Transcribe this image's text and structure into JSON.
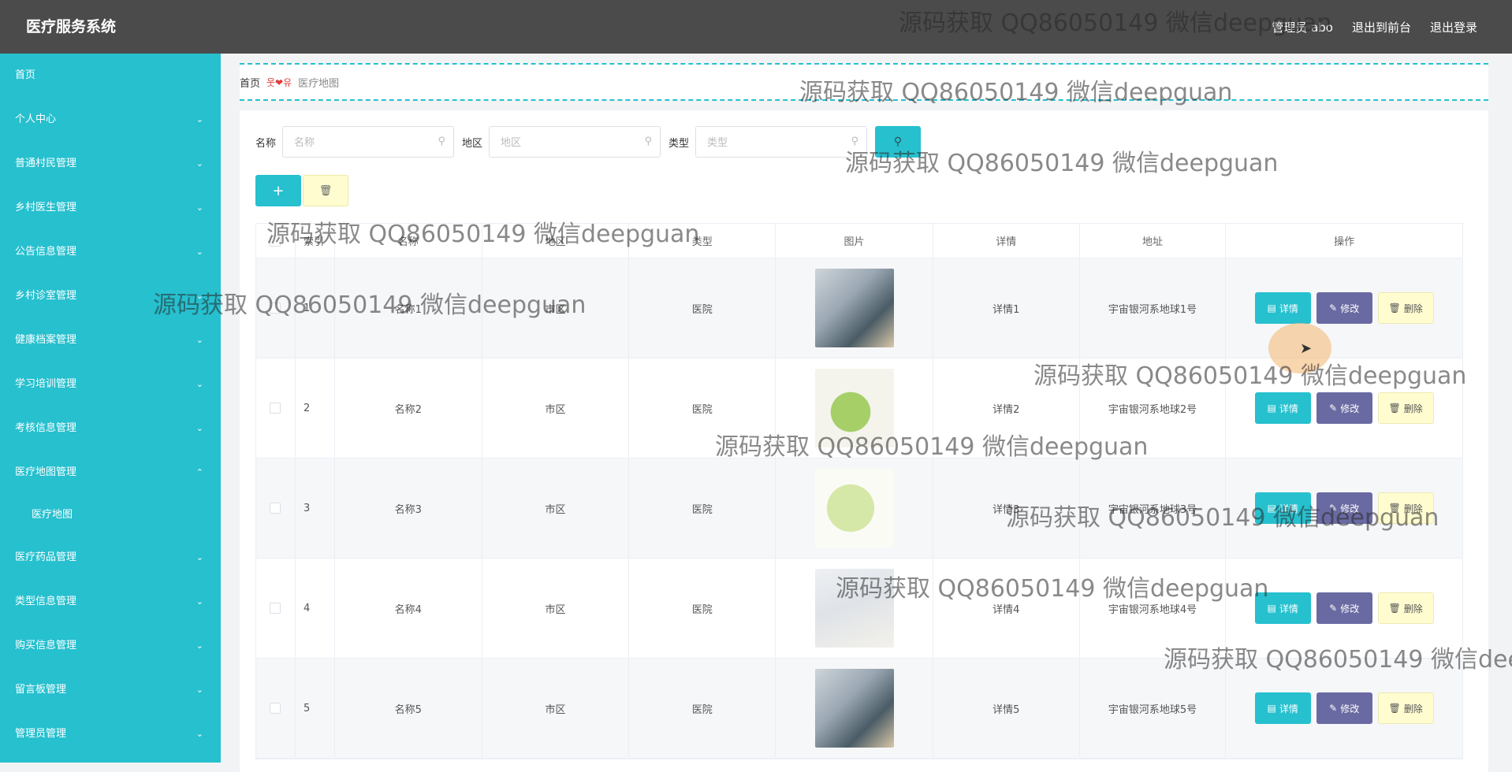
{
  "app": {
    "title": "医疗服务系统"
  },
  "header": {
    "user": "管理员 abo",
    "to_front": "退出到前台",
    "logout": "退出登录"
  },
  "sidebar": {
    "items": [
      {
        "label": "首页",
        "chev": ""
      },
      {
        "label": "个人中心",
        "chev": "⌄"
      },
      {
        "label": "普通村民管理",
        "chev": "⌄"
      },
      {
        "label": "乡村医生管理",
        "chev": "⌄"
      },
      {
        "label": "公告信息管理",
        "chev": "⌄"
      },
      {
        "label": "乡村诊室管理",
        "chev": "⌄"
      },
      {
        "label": "健康档案管理",
        "chev": "⌄"
      },
      {
        "label": "学习培训管理",
        "chev": "⌄"
      },
      {
        "label": "考核信息管理",
        "chev": "⌄"
      },
      {
        "label": "医疗地图管理",
        "chev": "⌃"
      },
      {
        "label": "医疗地图",
        "chev": ""
      },
      {
        "label": "医疗药品管理",
        "chev": "⌄"
      },
      {
        "label": "类型信息管理",
        "chev": "⌄"
      },
      {
        "label": "购买信息管理",
        "chev": "⌄"
      },
      {
        "label": "留言板管理",
        "chev": "⌄"
      },
      {
        "label": "管理员管理",
        "chev": "⌄"
      }
    ]
  },
  "breadcrumb": {
    "home": "首页",
    "sep": "웃❤유",
    "current": "医疗地图"
  },
  "search": {
    "name_label": "名称",
    "name_placeholder": "名称",
    "region_label": "地区",
    "region_placeholder": "地区",
    "type_label": "类型",
    "type_placeholder": "类型",
    "search_icon": "⚲"
  },
  "toolbar": {
    "add_icon": "+",
    "delete_icon": "🗑"
  },
  "table": {
    "headers": {
      "index": "索引",
      "name": "名称",
      "region": "地区",
      "type": "类型",
      "image": "图片",
      "detail": "详情",
      "address": "地址",
      "ops": "操作"
    },
    "buttons": {
      "detail": "详情",
      "edit": "修改",
      "remove": "删除"
    },
    "button_icons": {
      "detail": "▤",
      "edit": "✎",
      "remove": "🗑"
    },
    "rows": [
      {
        "index": "1",
        "name": "名称1",
        "region": "市区",
        "type": "医院",
        "detail": "详情1",
        "address": "宇宙银河系地球1号"
      },
      {
        "index": "2",
        "name": "名称2",
        "region": "市区",
        "type": "医院",
        "detail": "详情2",
        "address": "宇宙银河系地球2号"
      },
      {
        "index": "3",
        "name": "名称3",
        "region": "市区",
        "type": "医院",
        "detail": "详情3",
        "address": "宇宙银河系地球3号"
      },
      {
        "index": "4",
        "name": "名称4",
        "region": "市区",
        "type": "医院",
        "detail": "详情4",
        "address": "宇宙银河系地球4号"
      },
      {
        "index": "5",
        "name": "名称5",
        "region": "市区",
        "type": "医院",
        "detail": "详情5",
        "address": "宇宙银河系地球5号"
      }
    ]
  },
  "watermark": "源码获取 QQ86050149 微信deepguan",
  "colors": {
    "accent": "#26c0cf",
    "edit": "#6a6aa3",
    "remove_bg": "#fffdd0",
    "header_bg": "#4b4b4b"
  }
}
